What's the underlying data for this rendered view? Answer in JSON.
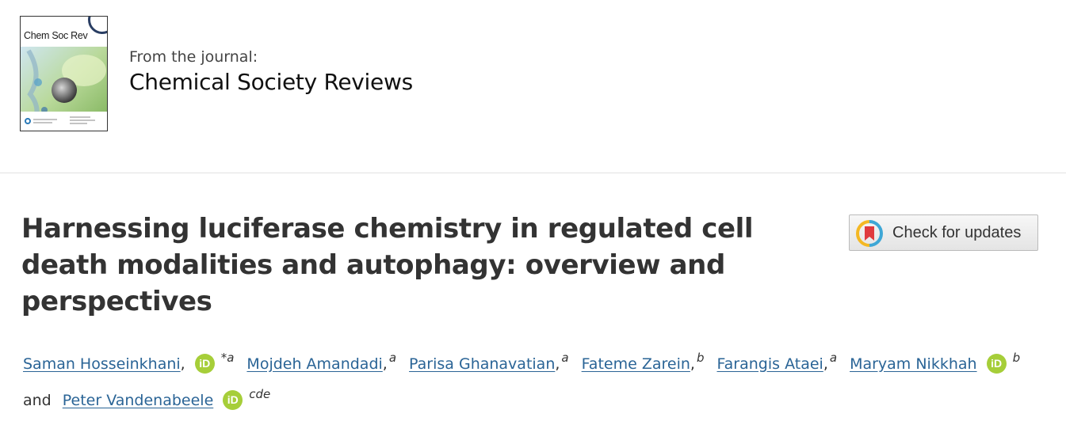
{
  "journal": {
    "cover_title": "Chem Soc Rev",
    "from_label": "From the journal:",
    "name": "Chemical Society Reviews"
  },
  "article": {
    "title": "Harnessing luciferase chemistry in regulated cell death modalities and autophagy: overview and perspectives"
  },
  "check_for_updates": {
    "label": "Check for updates"
  },
  "orcid_icon_text": "iD",
  "authors": [
    {
      "name": "Saman Hosseinkhani",
      "aff": "*a",
      "orcid": true
    },
    {
      "name": "Mojdeh Amandadi",
      "aff": "a",
      "orcid": false
    },
    {
      "name": "Parisa Ghanavatian",
      "aff": "a",
      "orcid": false
    },
    {
      "name": "Fateme Zarein",
      "aff": "b",
      "orcid": false
    },
    {
      "name": "Farangis Ataei",
      "aff": "a",
      "orcid": false
    },
    {
      "name": "Maryam Nikkhah",
      "aff": "b",
      "orcid": true
    },
    {
      "name": "Peter Vandenabeele",
      "aff": "cde",
      "orcid": true
    }
  ],
  "and_label": "and",
  "colors": {
    "link": "#2a6496",
    "orcid": "#a6ce39",
    "title": "#333333"
  }
}
